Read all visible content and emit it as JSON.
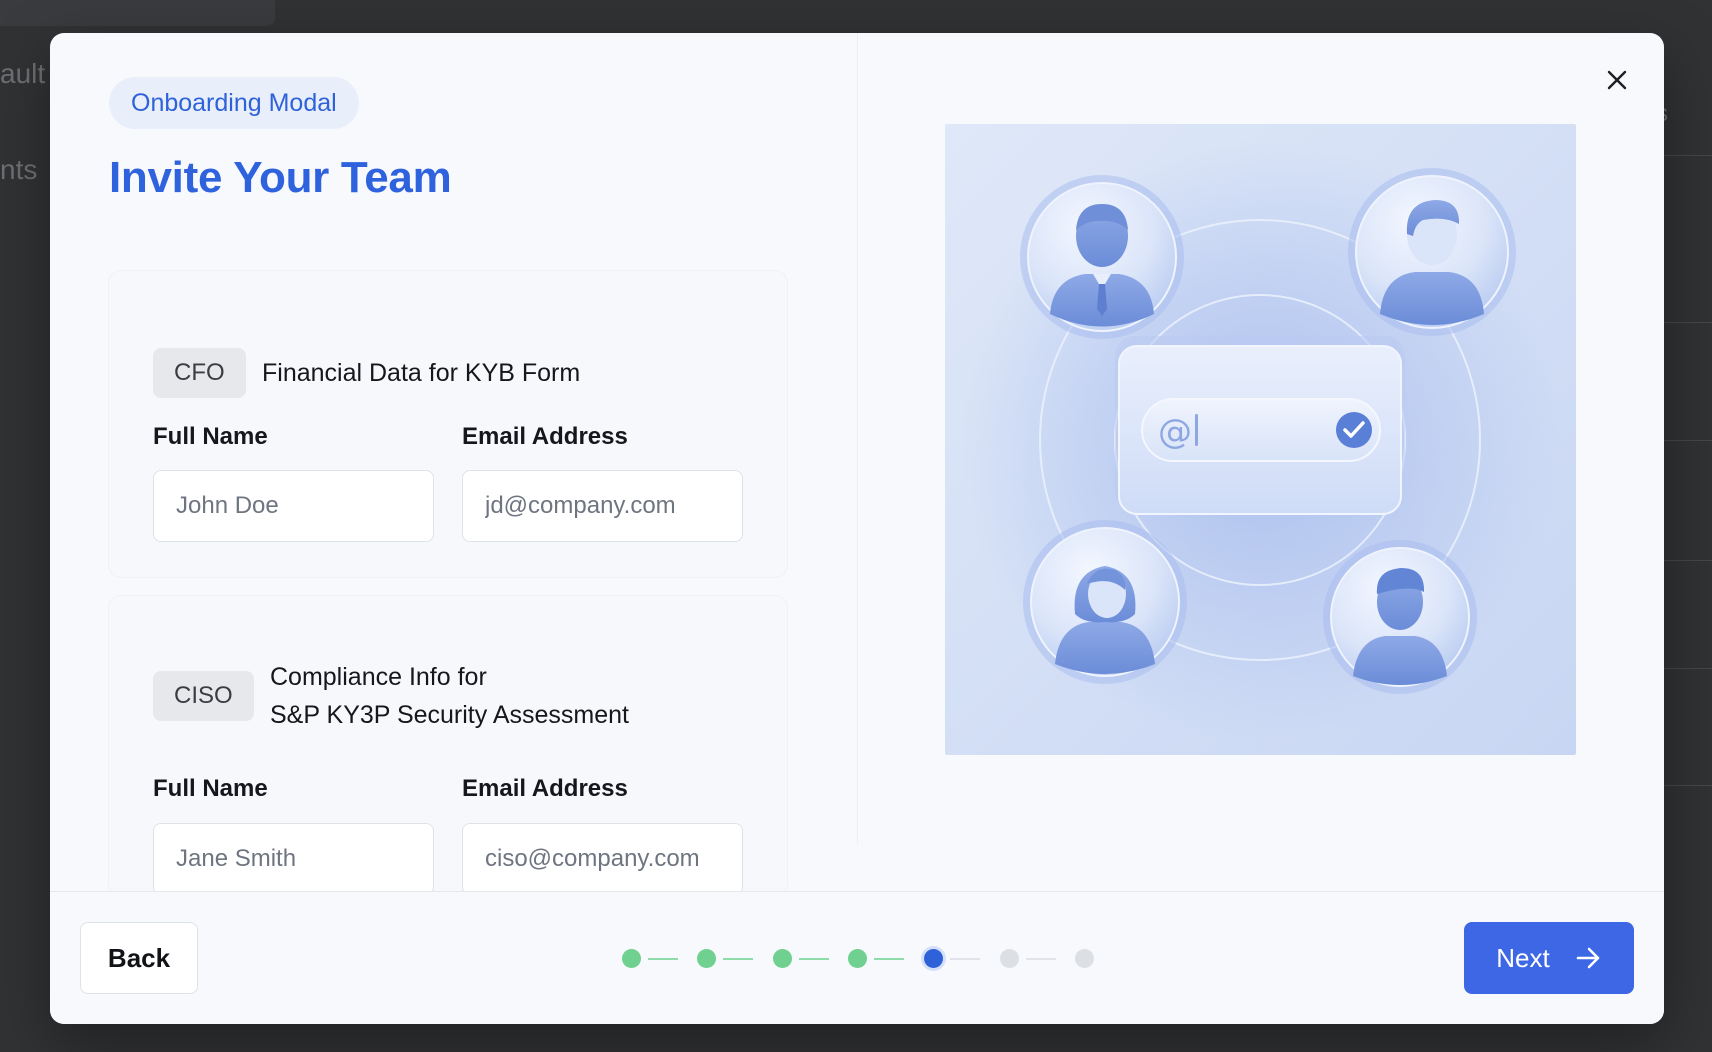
{
  "background": {
    "texts": [
      "ault",
      "nts",
      "s"
    ]
  },
  "modal": {
    "badge": "Onboarding Modal",
    "title": "Invite Your Team",
    "close_icon": "close-icon"
  },
  "cards": [
    {
      "role": "CFO",
      "description_prefix": "Financial Data for",
      "description_strong": "KYB Form",
      "name_label": "Full Name",
      "name_placeholder": "John Doe",
      "email_label": "Email Address",
      "email_placeholder": "jd@company.com"
    },
    {
      "role": "CISO",
      "description_line1": "Compliance Info for",
      "description_line2": "S&P KY3P Security Assessment",
      "name_label": "Full Name",
      "name_placeholder": "Jane Smith",
      "email_label": "Email Address",
      "email_placeholder": "ciso@company.com"
    }
  ],
  "illustration": {
    "email_symbol": "@",
    "icons": [
      "businessman-avatar-icon",
      "man-avatar-icon",
      "woman-avatar-icon",
      "man-avatar-icon",
      "email-input-icon",
      "check-icon"
    ]
  },
  "footer": {
    "back_label": "Back",
    "next_label": "Next",
    "next_icon": "arrow-right-icon",
    "steps": {
      "total": 7,
      "current": 5,
      "completed": 4
    }
  },
  "colors": {
    "accent": "#3e67e6",
    "title": "#2e63dd",
    "step_done": "#6fd090",
    "step_todo": "#dcdfe4"
  }
}
